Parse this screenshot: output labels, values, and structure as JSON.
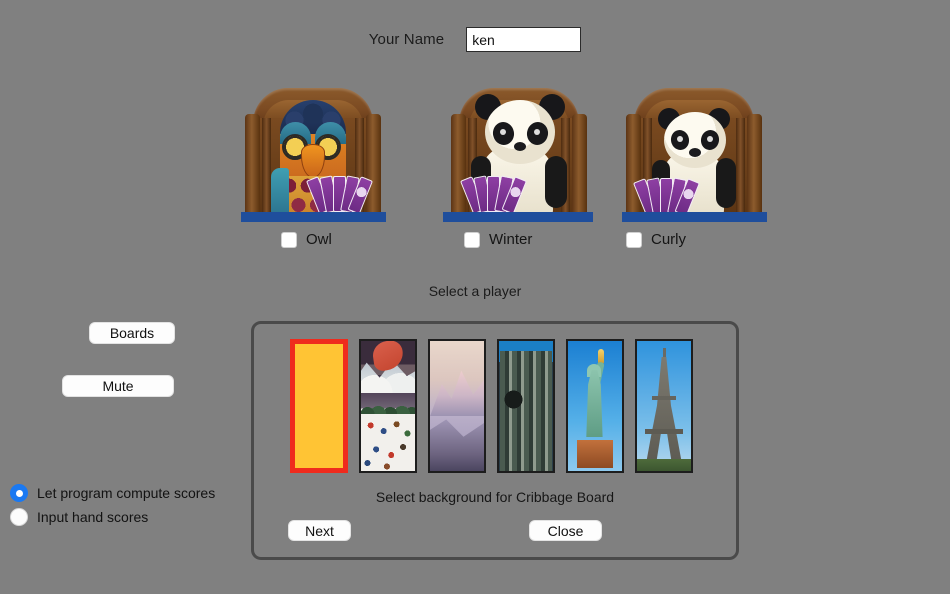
{
  "header": {
    "name_label": "Your Name",
    "name_value": "ken",
    "name_placeholder": "Your Name"
  },
  "players": {
    "prompt": "Select a player",
    "items": [
      {
        "label": "Owl",
        "figure": "owl-figurine-on-chair",
        "checked": false
      },
      {
        "label": "Winter",
        "figure": "panda-plush-on-chair",
        "checked": false
      },
      {
        "label": "Curly",
        "figure": "panda-plush-on-chair",
        "checked": false
      }
    ]
  },
  "side_buttons": {
    "boards": "Boards",
    "mute": "Mute"
  },
  "scoring": {
    "options": [
      {
        "label": "Let program compute scores",
        "selected": true
      },
      {
        "label": "Input hand scores",
        "selected": false
      }
    ]
  },
  "dialog": {
    "caption": "Select background for Cribbage Board",
    "next_label": "Next",
    "close_label": "Close",
    "thumbnails": [
      {
        "name": "plain-gold",
        "selected": true
      },
      {
        "name": "snowy-village",
        "selected": false
      },
      {
        "name": "pink-mountains",
        "selected": false
      },
      {
        "name": "cathedral-facade",
        "selected": false
      },
      {
        "name": "statue-of-liberty",
        "selected": false
      },
      {
        "name": "eiffel-tower",
        "selected": false
      }
    ]
  },
  "colors": {
    "background": "#808080",
    "table_bar": "#1f4e9c",
    "selection_border": "#ef2b1d",
    "radio_accent": "#1a79f2",
    "dialog_border": "#4a4a4a",
    "plain_swatch": "#ffc434"
  }
}
